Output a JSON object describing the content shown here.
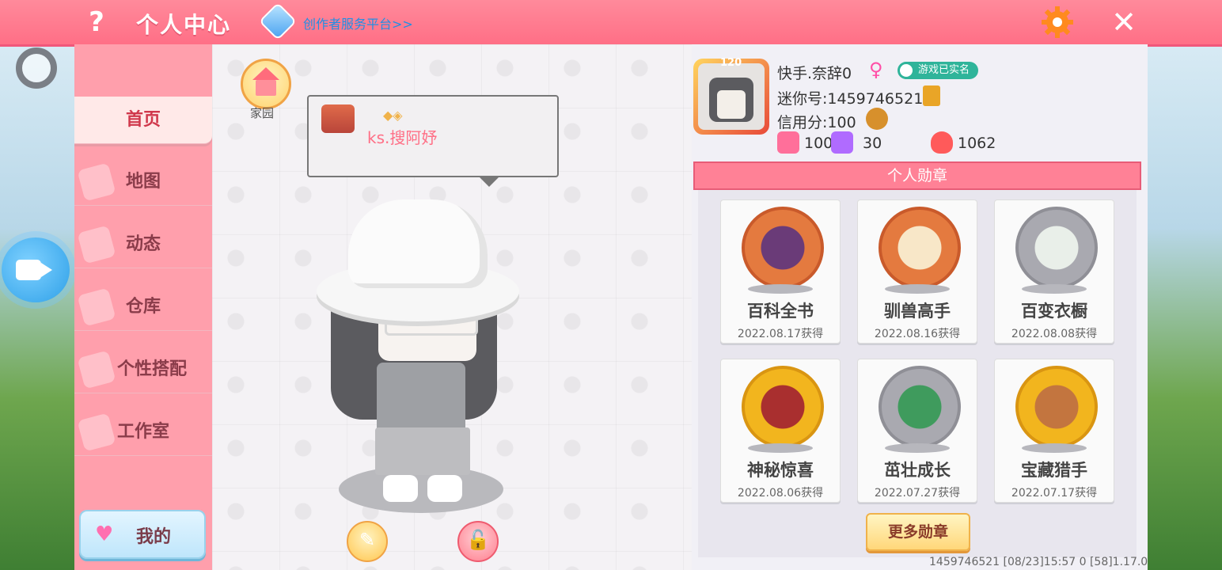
{
  "header": {
    "help_glyph": "?",
    "title": "个人中心",
    "platform_link": "创作者服务平台>>",
    "close_glyph": "✕"
  },
  "sidebar": {
    "items": [
      {
        "label": "首页"
      },
      {
        "label": "地图"
      },
      {
        "label": "动态"
      },
      {
        "label": "仓库"
      },
      {
        "label": "个性搭配"
      },
      {
        "label": "工作室"
      }
    ],
    "mine_label": "我的"
  },
  "center": {
    "home_label": "家园",
    "speech_name": "ks.搜阿妤",
    "edit_glyph": "✎",
    "lock_glyph": "🔓"
  },
  "profile": {
    "level": "120",
    "username": "快手.奈辞0",
    "gender_glyph": "♀",
    "verified": "游戏已实名",
    "mini_id": "迷你号:1459746521",
    "credit": "信用分:100",
    "stats": [
      {
        "value": "100",
        "icon": "star-card-icon",
        "color": "#ff6f9a"
      },
      {
        "value": "30",
        "icon": "fans-icon",
        "color": "#b06bff"
      },
      {
        "value": "1062",
        "icon": "fire-icon",
        "color": "#ff5a5a"
      }
    ]
  },
  "medals": {
    "header": "个人勋章",
    "items": [
      {
        "name": "百科全书",
        "date": "2022.08.17获得",
        "color": "#e47a3f"
      },
      {
        "name": "驯兽高手",
        "date": "2022.08.16获得",
        "color": "#e47a3f"
      },
      {
        "name": "百变衣橱",
        "date": "2022.08.08获得",
        "color": "#a9a9b0"
      },
      {
        "name": "神秘惊喜",
        "date": "2022.08.06获得",
        "color": "#f2b51e"
      },
      {
        "name": "茁壮成长",
        "date": "2022.07.27获得",
        "color": "#a9a9b0"
      },
      {
        "name": "宝藏猎手",
        "date": "2022.07.17获得",
        "color": "#f2b51e"
      }
    ],
    "more_label": "更多勋章"
  },
  "footer": {
    "text": "1459746521   [08/23]15:57 0   [58]1.17.0"
  },
  "colors": {
    "topbar": "#ff7a90",
    "sidebar": "#ff9fac",
    "accent": "#d0384c"
  }
}
